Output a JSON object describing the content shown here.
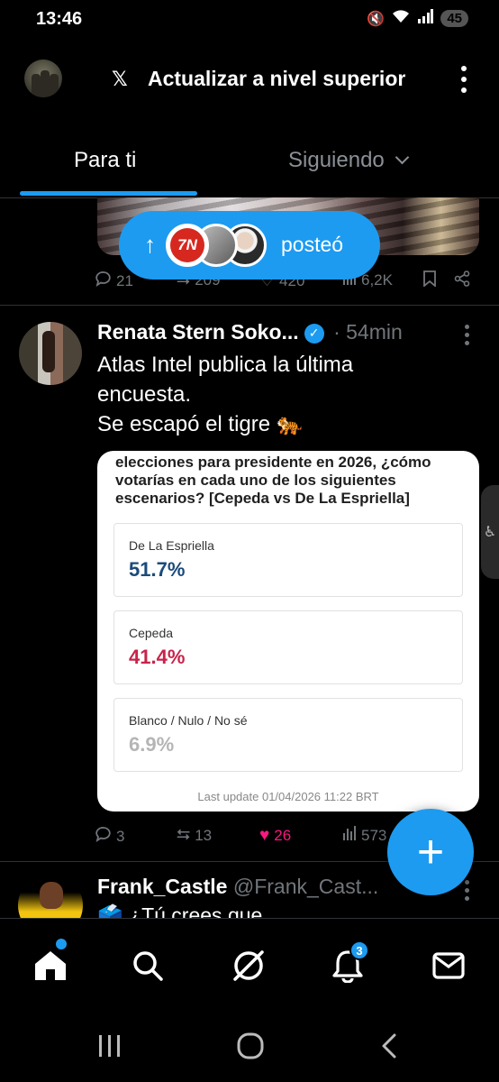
{
  "status_bar": {
    "time": "13:46",
    "battery": "45"
  },
  "header": {
    "upgrade_label": "Actualizar a nivel superior"
  },
  "tabs": [
    {
      "label": "Para ti",
      "active": true
    },
    {
      "label": "Siguiendo",
      "active": false
    }
  ],
  "posted_pill": {
    "label": "posteó",
    "badge_text": "7N"
  },
  "post1_actions": {
    "replies": "21",
    "reposts": "209",
    "likes": "420",
    "views": "6,2K"
  },
  "post2": {
    "author": "Renata Stern Soko...",
    "time": "· 54min",
    "text_lines": [
      "Atlas Intel publica la última",
      "encuesta.",
      "Se escapó el tigre 🐅"
    ],
    "poll": {
      "question": "elecciones para presidente en 2026, ¿cómo votarías en cada uno de los siguientes escenarios? [Cepeda vs De La Espriella]",
      "options": [
        {
          "label": "De La Espriella",
          "value": "51.7%",
          "color": "#1a4a7a"
        },
        {
          "label": "Cepeda",
          "value": "41.4%",
          "color": "#c8234a"
        },
        {
          "label": "Blanco / Nulo / No sé",
          "value": "6.9%",
          "color": "#b5b5b5"
        }
      ],
      "last_update": "Last update 01/04/2026 11:22 BRT"
    },
    "actions": {
      "replies": "3",
      "reposts": "13",
      "likes": "26",
      "views": "573"
    }
  },
  "post3": {
    "author": "Frank_Castle",
    "handle": "@Frank_Cast...",
    "text": "🗳️ ¿Tú crees que"
  },
  "bottom_nav": {
    "notifications_badge": "3"
  },
  "colors": {
    "accent": "#1d9bf0",
    "like": "#f91880",
    "muted": "#71767b"
  }
}
